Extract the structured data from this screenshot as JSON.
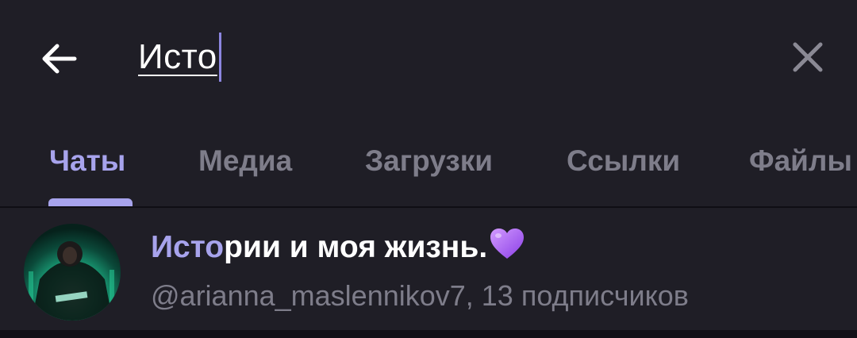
{
  "search": {
    "query": "Исто",
    "back_icon": "arrow-left-icon",
    "clear_icon": "close-icon"
  },
  "tabs": [
    {
      "label": "Чаты",
      "active": true
    },
    {
      "label": "Медиа",
      "active": false
    },
    {
      "label": "Загрузки",
      "active": false
    },
    {
      "label": "Ссылки",
      "active": false
    },
    {
      "label": "Файлы",
      "active": false
    }
  ],
  "results": [
    {
      "title_highlight": "Исто",
      "title_rest": "рии и моя жизнь.",
      "title_emoji": "purple-heart-icon",
      "subtitle": "@arianna_maslennikov7, 13 подписчиков",
      "avatar": "avatar-photo"
    }
  ],
  "colors": {
    "background": "#1f1e26",
    "accent": "#a7a3ec",
    "text_primary": "#ffffff",
    "text_secondary": "#7e7d8a"
  }
}
